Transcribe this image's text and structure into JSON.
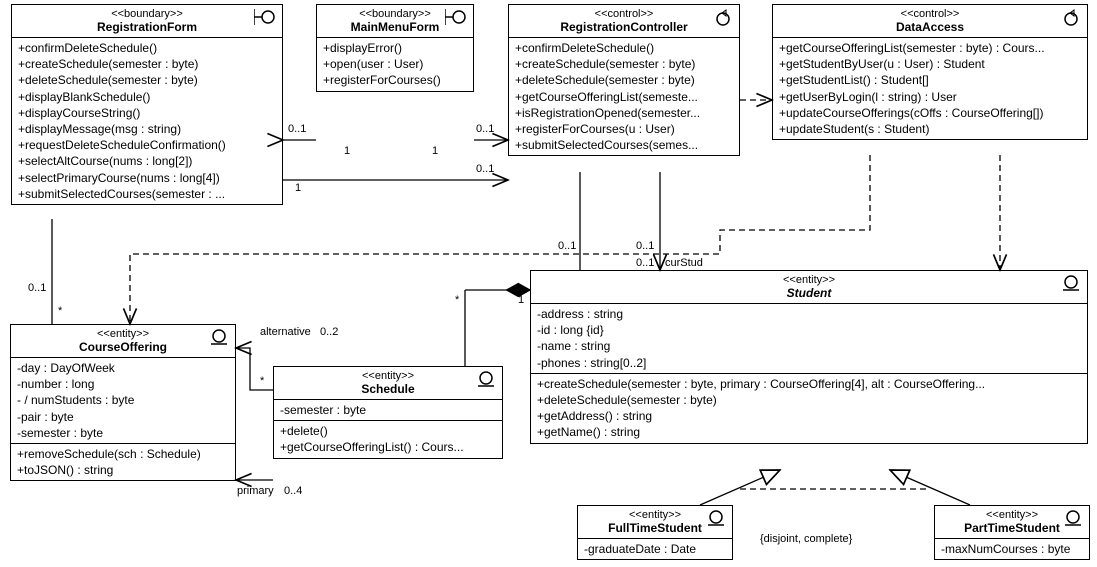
{
  "classes": {
    "registrationForm": {
      "stereotype": "<<boundary>>",
      "name": "RegistrationForm",
      "ops": [
        "+confirmDeleteSchedule()",
        "+createSchedule(semester : byte)",
        "+deleteSchedule(semester : byte)",
        "+displayBlankSchedule()",
        "+displayCourseString()",
        "+displayMessage(msg : string)",
        "+requestDeleteScheduleConfirmation()",
        "+selectAltCourse(nums : long[2])",
        "+selectPrimaryCourse(nums : long[4])",
        "+submitSelectedCourses(semester : ..."
      ]
    },
    "mainMenuForm": {
      "stereotype": "<<boundary>>",
      "name": "MainMenuForm",
      "ops": [
        "+displayError()",
        "+open(user : User)",
        "+registerForCourses()"
      ]
    },
    "registrationController": {
      "stereotype": "<<control>>",
      "name": "RegistrationController",
      "ops": [
        "+confirmDeleteSchedule()",
        "+createSchedule(semester : byte)",
        "+deleteSchedule(semester : byte)",
        "+getCourseOfferingList(semeste...",
        "+isRegistrationOpened(semester...",
        "+registerForCourses(u : User)",
        "+submitSelectedCourses(semes..."
      ]
    },
    "dataAccess": {
      "stereotype": "<<control>>",
      "name": "DataAccess",
      "ops": [
        "+getCourseOfferingList(semester : byte) : Cours...",
        "+getStudentByUser(u : User) : Student",
        "+getStudentList() : Student[]",
        "+getUserByLogin(l : string) : User",
        "+updateCourseOfferings(cOffs : CourseOffering[])",
        "+updateStudent(s : Student)"
      ]
    },
    "courseOffering": {
      "stereotype": "<<entity>>",
      "name": "CourseOffering",
      "attrs": [
        "-day : DayOfWeek",
        "-number : long",
        "- / numStudents : byte",
        "-pair : byte",
        "-semester : byte"
      ],
      "ops": [
        "+removeSchedule(sch : Schedule)",
        "+toJSON() : string"
      ]
    },
    "schedule": {
      "stereotype": "<<entity>>",
      "name": "Schedule",
      "attrs": [
        "-semester : byte"
      ],
      "ops": [
        "+delete()",
        "+getCourseOfferingList() : Cours..."
      ]
    },
    "student": {
      "stereotype": "<<entity>>",
      "name": "Student",
      "attrs": [
        "-address : string",
        "-id : long {id}",
        "-name : string",
        "-phones : string[0..2]"
      ],
      "ops": [
        "+createSchedule(semester : byte, primary : CourseOffering[4], alt : CourseOffering...",
        "+deleteSchedule(semester : byte)",
        "+getAddress() : string",
        "+getName() : string"
      ]
    },
    "fullTimeStudent": {
      "stereotype": "<<entity>>",
      "name": "FullTimeStudent",
      "attrs": [
        "-graduateDate : Date"
      ]
    },
    "partTimeStudent": {
      "stereotype": "<<entity>>",
      "name": "PartTimeStudent",
      "attrs": [
        "-maxNumCourses : byte"
      ]
    }
  },
  "labels": {
    "disjoint": "{disjoint, complete}",
    "curStud": "curStud",
    "alternative": "alternative",
    "primary": "primary",
    "m001a": "0..1",
    "m001b": "0..1",
    "m001c": "0..1",
    "m001d": "0..1",
    "m001e": "0..1",
    "m001f": "0..1",
    "m001g": "0..1",
    "mStar1": "*",
    "mStar2": "*",
    "mStar3": "*",
    "m1a": "1",
    "m1b": "1",
    "m1c": "1",
    "m1d": "1",
    "m02": "0..2",
    "m04": "0..4"
  },
  "chart_data": {
    "type": "uml_class_diagram",
    "classes": [
      {
        "name": "RegistrationForm",
        "stereotype": "boundary"
      },
      {
        "name": "MainMenuForm",
        "stereotype": "boundary"
      },
      {
        "name": "RegistrationController",
        "stereotype": "control"
      },
      {
        "name": "DataAccess",
        "stereotype": "control"
      },
      {
        "name": "CourseOffering",
        "stereotype": "entity"
      },
      {
        "name": "Schedule",
        "stereotype": "entity"
      },
      {
        "name": "Student",
        "stereotype": "entity",
        "abstract": true
      },
      {
        "name": "FullTimeStudent",
        "stereotype": "entity"
      },
      {
        "name": "PartTimeStudent",
        "stereotype": "entity"
      }
    ],
    "relationships": [
      {
        "from": "RegistrationForm",
        "to": "MainMenuForm",
        "type": "association",
        "nav": "MainMenuForm",
        "mult_from": "0..1",
        "mult_to": "1"
      },
      {
        "from": "MainMenuForm",
        "to": "RegistrationController",
        "type": "association",
        "nav": "RegistrationController",
        "mult_from": "1",
        "mult_to": "0..1"
      },
      {
        "from": "RegistrationForm",
        "to": "RegistrationController",
        "type": "association",
        "nav": "RegistrationController",
        "mult_from": "1",
        "mult_to": "0..1"
      },
      {
        "from": "RegistrationForm",
        "to": "CourseOffering",
        "type": "association",
        "mult_from": "0..1",
        "mult_to": "*"
      },
      {
        "from": "RegistrationController",
        "to": "Student",
        "type": "association",
        "nav": "Student",
        "role_to": "curStud",
        "mult_from": "0..1",
        "mult_to": "0..1"
      },
      {
        "from": "RegistrationController",
        "to": "DataAccess",
        "type": "dependency"
      },
      {
        "from": "DataAccess",
        "to": "Student",
        "type": "dependency"
      },
      {
        "from": "DataAccess",
        "to": "CourseOffering",
        "type": "dependency"
      },
      {
        "from": "Student",
        "to": "Schedule",
        "type": "composition",
        "mult_from": "1",
        "mult_to": "*"
      },
      {
        "from": "Schedule",
        "to": "CourseOffering",
        "type": "association",
        "nav": "CourseOffering",
        "role": "alternative",
        "mult_from": "*",
        "mult_to": "0..2"
      },
      {
        "from": "Schedule",
        "to": "CourseOffering",
        "type": "association",
        "nav": "CourseOffering",
        "role": "primary",
        "mult_from": "*",
        "mult_to": "0..4"
      },
      {
        "from": "FullTimeStudent",
        "to": "Student",
        "type": "generalization"
      },
      {
        "from": "PartTimeStudent",
        "to": "Student",
        "type": "generalization"
      }
    ],
    "constraints": [
      {
        "text": "{disjoint, complete}",
        "on": [
          "FullTimeStudent-Student",
          "PartTimeStudent-Student"
        ]
      }
    ]
  }
}
